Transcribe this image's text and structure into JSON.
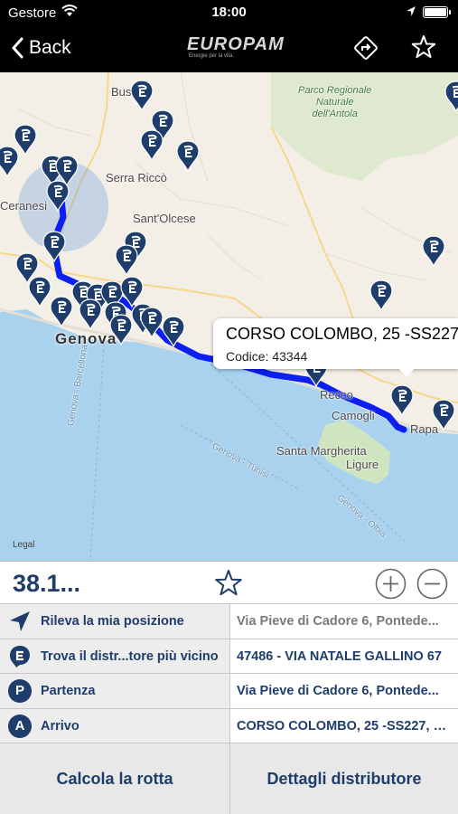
{
  "status_bar": {
    "carrier": "Gestore",
    "time": "18:00",
    "battery_level": 1.0
  },
  "nav": {
    "back_label": "Back",
    "logo_text": "EUROPAM",
    "logo_tagline": "Energie per la vita."
  },
  "map": {
    "places": {
      "busalla": "Bus",
      "serra_ricco": "Serra Riccò",
      "ceranesi": "Ceranesi",
      "sant_olcese": "Sant'Olcese",
      "genova": "Genova",
      "recco": "Recco",
      "camogli": "Camogli",
      "santa_margherita": "Santa Margherita",
      "ligure": "Ligure",
      "rapallo": "Rapa",
      "park_1": "Parco Regionale",
      "park_2": "Naturale",
      "park_3": "dell'Antola",
      "sea_1": "Genova - Barcellona",
      "sea_2": "Genova - Tunisi",
      "sea_3": "Genova - Olbia"
    },
    "legal": "Legal",
    "callout": {
      "name": "CORSO COLOMBO, 25 -SS227",
      "code": "Codice: 43344"
    },
    "colors": {
      "route": "#0a1ff0",
      "pin": "#1e3d6b",
      "sea": "#a9d2ef",
      "land": "#f3efe6",
      "park": "#cfe5bf"
    }
  },
  "distance": {
    "value": "38.1..."
  },
  "rows": [
    {
      "label": "Rileva la mia posizione",
      "value": "Via Pieve di Cadore 6, Pontede...",
      "icon": "location-arrow-icon"
    },
    {
      "label": "Trova il distr...tore più vicino",
      "value": "47486 - VIA NATALE GALLINO 67",
      "icon": "europam-e-icon"
    },
    {
      "label": "Partenza",
      "value": "Via Pieve di Cadore 6, Pontede...",
      "icon": "P"
    },
    {
      "label": "Arrivo",
      "value": "CORSO COLOMBO, 25 -SS227, R...",
      "icon": "A"
    }
  ],
  "buttons": {
    "calculate": "Calcola la rotta",
    "details": "Dettagli distributore"
  }
}
